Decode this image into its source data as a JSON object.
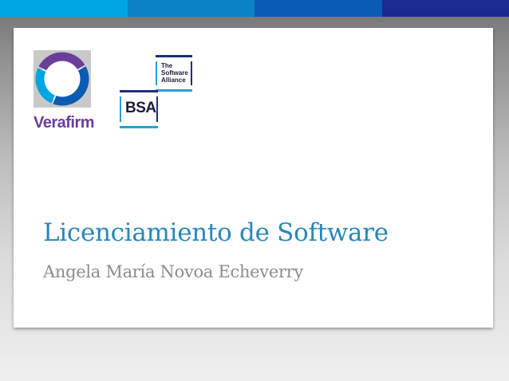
{
  "header": {
    "accent_bar_colors": [
      "#00a6e2",
      "#0a82c3",
      "#0a5bb3",
      "#1a2a8e"
    ]
  },
  "slide": {
    "title": "Licenciamiento de Software",
    "subtitle": "Angela María Novoa Echeverry"
  },
  "logos": {
    "verafirm": {
      "wordmark": "Verafirm",
      "ring_colors": [
        "#6a3e9a",
        "#0a5bb3",
        "#00a6e2"
      ]
    },
    "bsa": {
      "tagline": "The Software Alliance",
      "wordmark": "BSA"
    }
  }
}
